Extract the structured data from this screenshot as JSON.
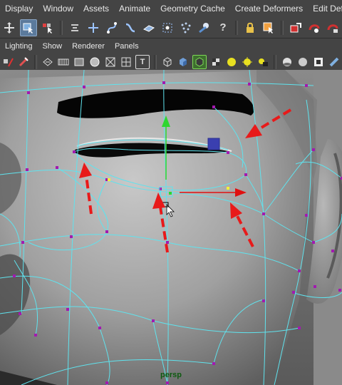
{
  "menubar": {
    "items": [
      "Display",
      "Window",
      "Assets",
      "Animate",
      "Geometry Cache",
      "Create Deformers",
      "Edit Deform"
    ]
  },
  "toolbar": {
    "icons": [
      "move-tool-icon",
      "select-object-icon",
      "select-component-icon",
      "snap-grid-icon",
      "snap-curve-icon",
      "snap-point-icon",
      "snap-plane-icon",
      "make-live-icon",
      "history-icon",
      "lock-icon",
      "input-ops-icon",
      "render-icon",
      "ipr-render-icon",
      "render-settings-icon"
    ],
    "help_glyph": "?"
  },
  "panel_menu": {
    "items": [
      "Lighting",
      "Show",
      "Renderer",
      "Panels"
    ]
  },
  "panel_toolbar": {
    "text_icon_glyph": "T"
  },
  "viewport": {
    "camera_label": "persp",
    "colors": {
      "wire": "#5fe3ee",
      "vertex": "#a21ab0",
      "arrow": "#e81a1a",
      "y_axis": "#2fd62f",
      "x_axis": "#e01010",
      "handle": "#3a3fb0"
    }
  }
}
